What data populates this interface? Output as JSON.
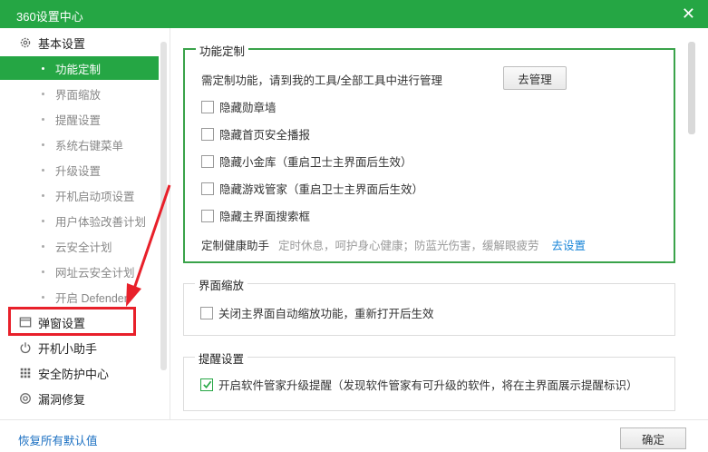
{
  "window": {
    "title": "360设置中心",
    "close_glyph": "✕"
  },
  "sidebar": {
    "groups": [
      {
        "label": "基本设置",
        "icon": "gear-icon"
      },
      {
        "label": "弹窗设置",
        "icon": "window-icon"
      },
      {
        "label": "开机小助手",
        "icon": "power-icon"
      },
      {
        "label": "安全防护中心",
        "icon": "grid-icon"
      },
      {
        "label": "漏洞修复",
        "icon": "target-icon"
      }
    ],
    "items": [
      "功能定制",
      "界面缩放",
      "提醒设置",
      "系统右键菜单",
      "升级设置",
      "开机启动项设置",
      "用户体验改善计划",
      "云安全计划",
      "网址云安全计划",
      "开启 Defender"
    ]
  },
  "custom": {
    "title": "功能定制",
    "manage_hint": "需定制功能，请到我的工具/全部工具中进行管理",
    "manage_button": "去管理",
    "options": [
      "隐藏勋章墙",
      "隐藏首页安全播报",
      "隐藏小金库（重启卫士主界面后生效）",
      "隐藏游戏管家（重启卫士主界面后生效）",
      "隐藏主界面搜索框"
    ],
    "health_label": "定制健康助手",
    "health_desc": "定时休息，呵护身心健康；防蓝光伤害，缓解眼疲劳",
    "health_link": "去设置"
  },
  "zoom": {
    "title": "界面缩放",
    "option": "关闭主界面自动缩放功能，重新打开后生效"
  },
  "reminder": {
    "title": "提醒设置",
    "option": "开启软件管家升级提醒（发现软件管家有可升级的软件，将在主界面展示提醒标识）"
  },
  "footer": {
    "restore": "恢复所有默认值",
    "ok": "确定"
  },
  "colors": {
    "accent": "#25a644",
    "highlight": "#e8202a",
    "link": "#1a86d8"
  }
}
